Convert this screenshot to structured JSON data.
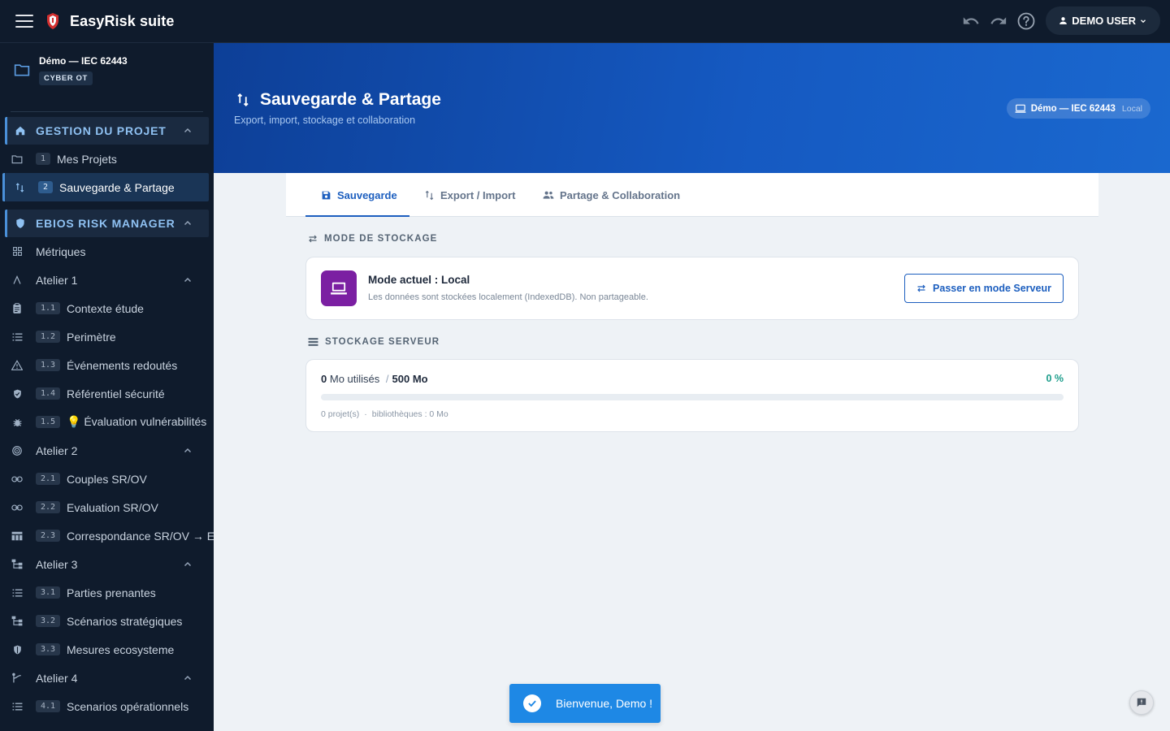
{
  "app": {
    "title": "EasyRisk suite"
  },
  "header": {
    "user_label": "DEMO USER"
  },
  "project": {
    "name": "Démo — IEC 62443",
    "tag": "CYBER OT",
    "mode": "Local"
  },
  "sidebar": {
    "sections": [
      {
        "label": "GESTION DU PROJET"
      },
      {
        "label": "EBIOS RISK MANAGER"
      }
    ],
    "items": [
      {
        "num": "1",
        "label": "Mes Projets",
        "icon": "folder-icon"
      },
      {
        "num": "2",
        "label": "Sauvegarde & Partage",
        "icon": "swap-vert-icon",
        "active": true
      },
      {
        "label": "Métriques",
        "icon": "grid-icon"
      },
      {
        "label": "Atelier 1",
        "icon": "atelier-icon"
      },
      {
        "num": "1.1",
        "label": "Contexte étude",
        "icon": "clipboard-icon"
      },
      {
        "num": "1.2",
        "label": "Perimètre",
        "icon": "list-icon"
      },
      {
        "num": "1.3",
        "label": "Événements redoutés",
        "icon": "warning-icon"
      },
      {
        "num": "1.4",
        "label": "Référentiel sécurité",
        "icon": "shield-check-icon"
      },
      {
        "num": "1.5",
        "label": "💡 Évaluation vulnérabilités",
        "icon": "bug-icon"
      },
      {
        "label": "Atelier 2",
        "icon": "target-icon"
      },
      {
        "num": "2.1",
        "label": "Couples SR/OV",
        "icon": "link-icon"
      },
      {
        "num": "2.2",
        "label": "Evaluation SR/OV",
        "icon": "link-icon"
      },
      {
        "num": "2.3",
        "label": "Correspondance SR/OV → EF",
        "icon": "table-icon"
      },
      {
        "label": "Atelier 3",
        "icon": "hierarchy-icon"
      },
      {
        "num": "3.1",
        "label": "Parties prenantes",
        "icon": "list-icon"
      },
      {
        "num": "3.2",
        "label": "Scénarios stratégiques",
        "icon": "hierarchy-icon"
      },
      {
        "num": "3.3",
        "label": "Mesures ecosysteme",
        "icon": "shield-icon"
      },
      {
        "label": "Atelier 4",
        "icon": "route-icon"
      },
      {
        "num": "4.1",
        "label": "Scenarios opérationnels",
        "icon": "list-icon"
      }
    ]
  },
  "page": {
    "title": "Sauvegarde & Partage",
    "subtitle": "Export, import, stockage et collaboration"
  },
  "tabs": [
    {
      "label": "Sauvegarde",
      "active": true
    },
    {
      "label": "Export / Import"
    },
    {
      "label": "Partage & Collaboration"
    }
  ],
  "storage_mode": {
    "heading": "MODE DE STOCKAGE",
    "title_prefix": "Mode actuel :",
    "current": "Local",
    "description": "Les données sont stockées localement (IndexedDB). Non partageable.",
    "button_label": "Passer en mode Serveur"
  },
  "server_storage": {
    "heading": "STOCKAGE SERVEUR",
    "used_value": "0",
    "used_label": "Mo utilisés",
    "separator": "/",
    "total": "500 Mo",
    "percent_label": "0 %",
    "percent": 0,
    "projects": "0 projet(s)",
    "dot": "·",
    "libraries": "bibliothèques : 0 Mo"
  },
  "toast": {
    "message": "Bienvenue, Demo !"
  },
  "colors": {
    "accent": "#1d5fbf",
    "mode_icon_bg": "#7b1fa2",
    "success": "#1e9e8c",
    "toast_bg": "#1e88e5"
  }
}
